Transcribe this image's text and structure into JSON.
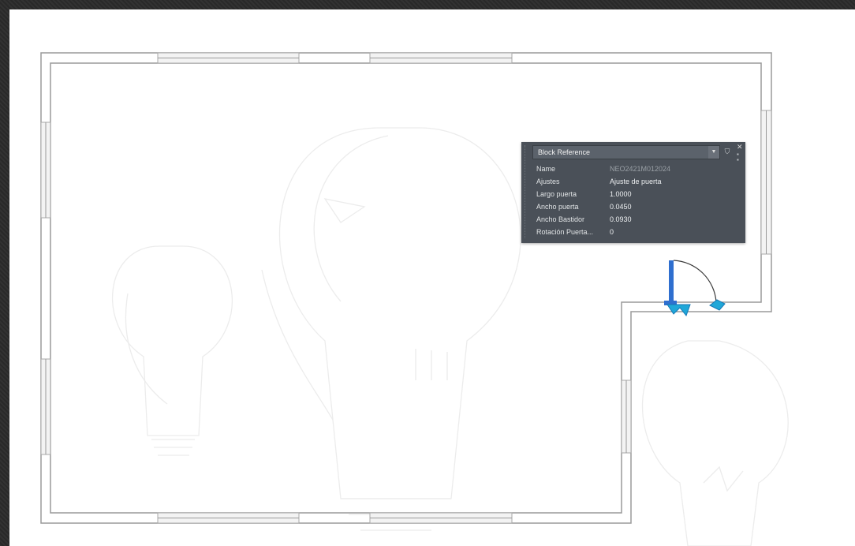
{
  "properties_palette": {
    "selector_label": "Block Reference",
    "dropdown_icon": "chevron-down-icon",
    "quick_select_icon": "quick-select-icon",
    "close_icon": "close-icon",
    "rows": [
      {
        "label": "Name",
        "value": "NEO2421M012024"
      },
      {
        "label": "Ajustes",
        "value": "Ajuste de puerta"
      },
      {
        "label": "Largo puerta",
        "value": "1.0000"
      },
      {
        "label": "Ancho puerta",
        "value": "0.0450"
      },
      {
        "label": "Ancho Bastidor",
        "value": "0.0930"
      },
      {
        "label": "Rotación Puerta...",
        "value": "0"
      }
    ]
  },
  "colors": {
    "wall": "#9a9a9a",
    "window": "#c8c8c8",
    "door_selected": "#2f6fcf",
    "grip": "#1fa7d8",
    "palette_bg": "#4a5058"
  }
}
